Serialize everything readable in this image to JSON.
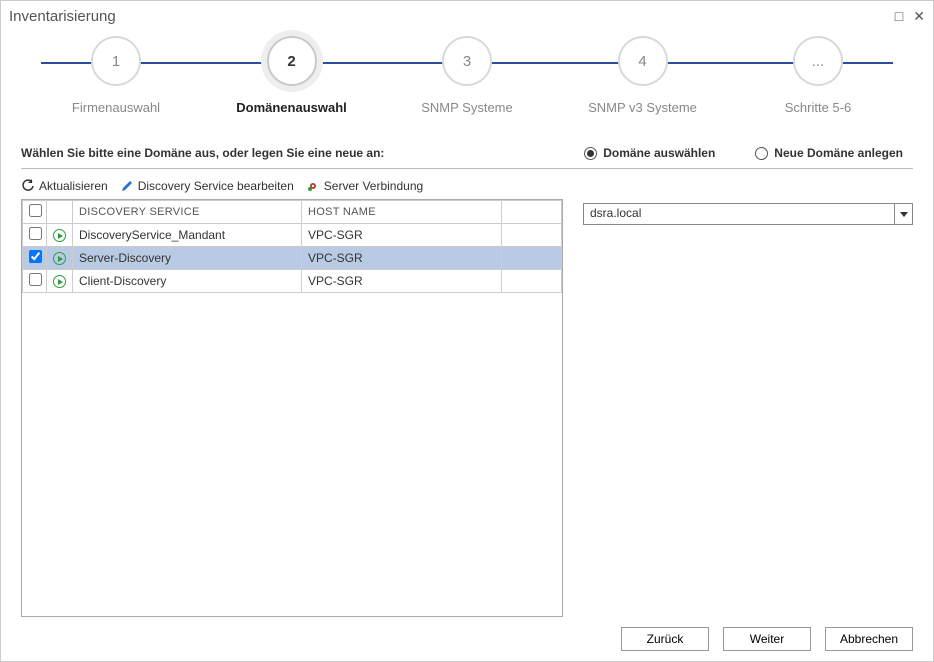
{
  "title": "Inventarisierung",
  "steps": [
    {
      "num": "1",
      "label": "Firmenauswahl",
      "active": false
    },
    {
      "num": "2",
      "label": "Domänenauswahl",
      "active": true
    },
    {
      "num": "3",
      "label": "SNMP Systeme",
      "active": false
    },
    {
      "num": "4",
      "label": "SNMP v3 Systeme",
      "active": false
    },
    {
      "num": "...",
      "label": "Schritte 5-6",
      "active": false
    }
  ],
  "instruction": "Wählen Sie bitte eine Domäne aus, oder legen Sie eine neue an:",
  "radios": {
    "select": "Domäne auswählen",
    "create": "Neue Domäne anlegen",
    "selected": "select"
  },
  "toolbar": {
    "refresh": "Aktualisieren",
    "edit": "Discovery Service bearbeiten",
    "server": "Server Verbindung"
  },
  "table": {
    "headers": {
      "service": "DISCOVERY SERVICE",
      "host": "HOST NAME"
    },
    "rows": [
      {
        "checked": false,
        "service": "DiscoveryService_Mandant",
        "host": "VPC-SGR",
        "selected": false
      },
      {
        "checked": true,
        "service": "Server-Discovery",
        "host": "VPC-SGR",
        "selected": true
      },
      {
        "checked": false,
        "service": "Client-Discovery",
        "host": "VPC-SGR",
        "selected": false
      }
    ]
  },
  "domain_combo": {
    "value": "dsra.local"
  },
  "footer": {
    "back": "Zurück",
    "next": "Weiter",
    "cancel": "Abbrechen"
  }
}
